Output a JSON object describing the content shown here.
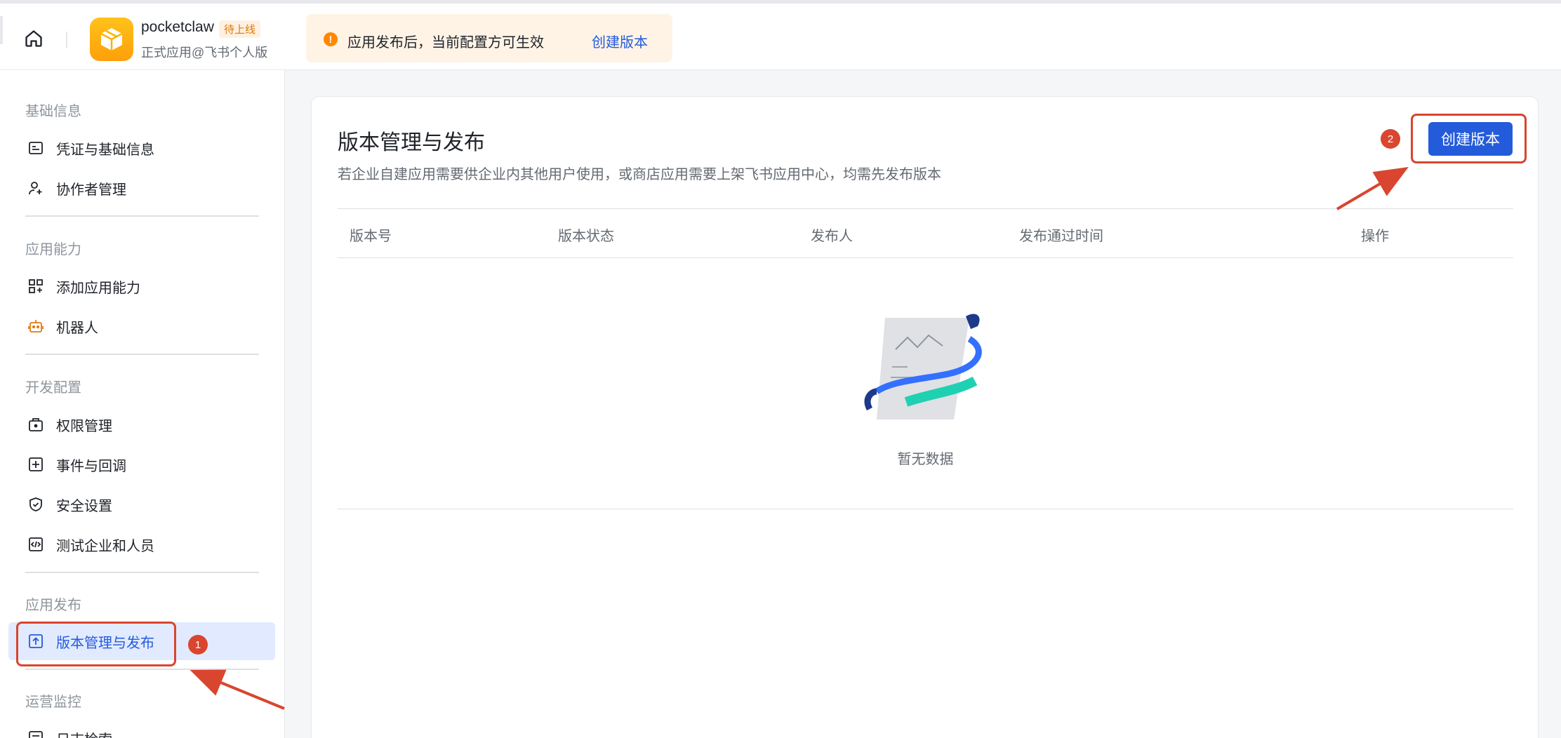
{
  "header": {
    "app_name": "pocketclaw",
    "status_badge": "待上线",
    "app_subtitle": "正式应用@飞书个人版",
    "notice_text": "应用发布后，当前配置方可生效",
    "notice_link": "创建版本",
    "notice_icon": "!"
  },
  "sidebar": {
    "groups": [
      {
        "title": "基础信息",
        "items": [
          {
            "label": "凭证与基础信息",
            "icon": "credential-icon"
          },
          {
            "label": "协作者管理",
            "icon": "user-add-icon"
          }
        ]
      },
      {
        "title": "应用能力",
        "items": [
          {
            "label": "添加应用能力",
            "icon": "apps-add-icon"
          },
          {
            "label": "机器人",
            "icon": "robot-icon"
          }
        ]
      },
      {
        "title": "开发配置",
        "items": [
          {
            "label": "权限管理",
            "icon": "permission-icon"
          },
          {
            "label": "事件与回调",
            "icon": "event-icon"
          },
          {
            "label": "安全设置",
            "icon": "shield-icon"
          },
          {
            "label": "测试企业和人员",
            "icon": "code-icon"
          }
        ]
      },
      {
        "title": "应用发布",
        "items": [
          {
            "label": "版本管理与发布",
            "icon": "upload-icon",
            "active": true
          }
        ]
      },
      {
        "title": "运营监控",
        "items": [
          {
            "label": "日志检索",
            "icon": "log-icon"
          }
        ]
      }
    ]
  },
  "main": {
    "title": "版本管理与发布",
    "description": "若企业自建应用需要供企业内其他用户使用，或商店应用需要上架飞书应用中心，均需先发布版本",
    "create_button": "创建版本",
    "columns": [
      "版本号",
      "版本状态",
      "发布人",
      "发布通过时间",
      "操作"
    ],
    "empty_text": "暂无数据"
  },
  "annotations": {
    "marker_1": "1",
    "marker_2": "2"
  },
  "colors": {
    "accent": "#245bdb",
    "annotation": "#d9452f",
    "notice_bg": "#fff3e6",
    "active_bg": "#e1eaff"
  }
}
